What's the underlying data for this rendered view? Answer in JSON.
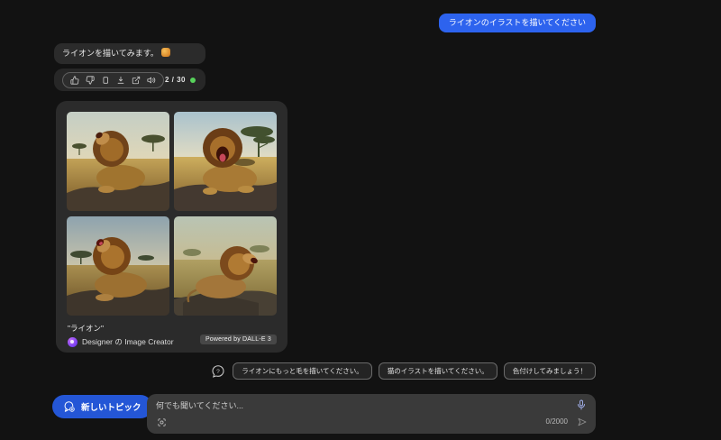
{
  "conversation": {
    "user_message": "ライオンのイラストを描いてください",
    "bot_message": {
      "text": "ライオンを描いてみます。",
      "emoji": "🦁"
    },
    "toolbar": {
      "icons": [
        "thumbs-up-icon",
        "thumbs-down-icon",
        "copy-icon",
        "download-icon",
        "share-icon",
        "read-aloud-icon"
      ],
      "turn_counter": "2 / 30"
    }
  },
  "image_card": {
    "caption": "\"ライオン\"",
    "attribution": {
      "logo": "designer-logo",
      "label": "Designer の Image Creator"
    },
    "badge": "Powered by DALL-E 3",
    "images": [
      {
        "description": "Roaring lion on a rock with raised head, savanna and acacia trees"
      },
      {
        "description": "Roaring lion facing forward on a rock, large acacia tree on the right"
      },
      {
        "description": "Lion roaring with head tilted back under an overcast sky"
      },
      {
        "description": "Lion lying on a rock in profile roaring, blurred savanna background"
      }
    ]
  },
  "suggestions": {
    "help_icon": "question-bubble-icon",
    "chips": [
      "ライオンにもっと毛を描いてください。",
      "猫のイラストを描いてください。",
      "色付けしてみましょう！"
    ]
  },
  "composer": {
    "new_topic_label": "新しいトピック",
    "placeholder": "何でも聞いてください...",
    "char_counter": "0/2000",
    "icons": [
      "new-topic-icon",
      "add-image-icon",
      "microphone-icon",
      "send-icon"
    ]
  },
  "colors": {
    "background": "#121212",
    "user_bubble": "#2d63ee",
    "bot_bubble": "#2b2b2b",
    "new_topic_button": "#2456d6",
    "input_background": "#3a3a3a",
    "status_green": "#57d25b",
    "mic_accent": "#a9b7f5",
    "designer_purple": "#7a3ff2"
  }
}
